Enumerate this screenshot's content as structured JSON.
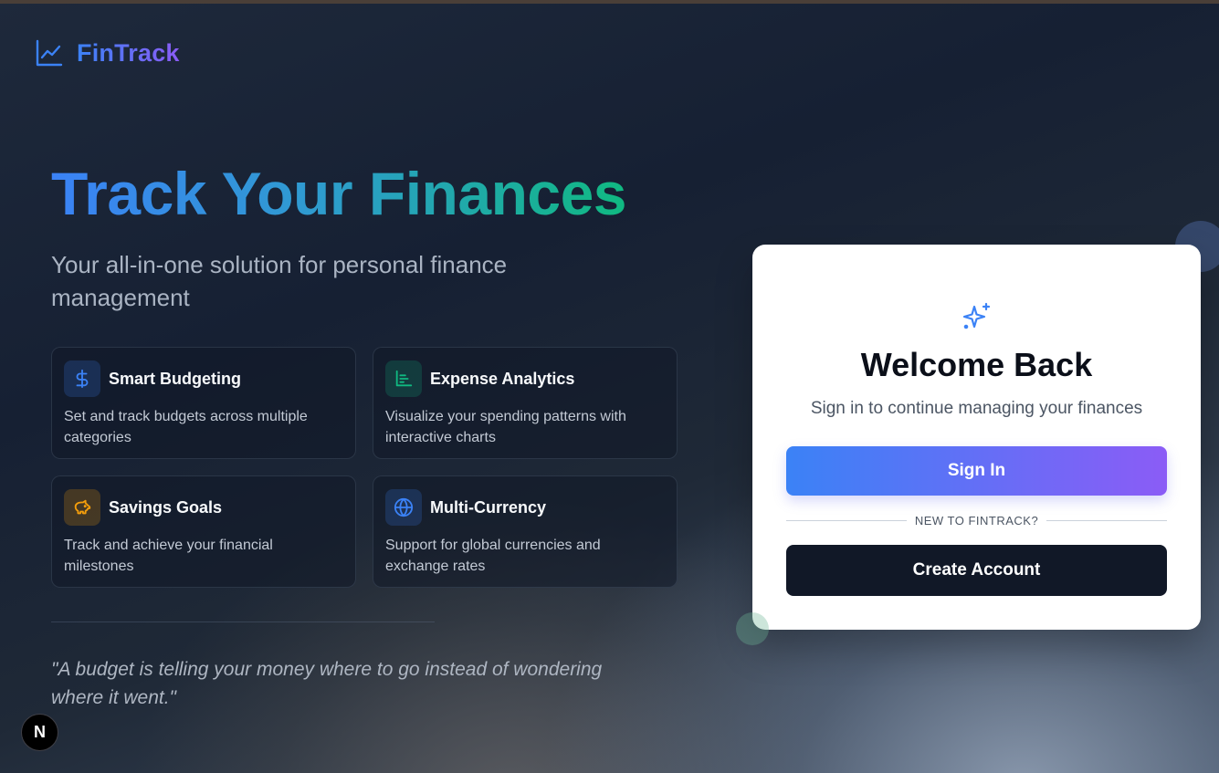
{
  "brand": {
    "name": "FinTrack",
    "icon": "line-chart-icon"
  },
  "hero": {
    "title": "Track Your Finances",
    "subtitle": "Your all-in-one solution for personal finance management"
  },
  "features": [
    {
      "title": "Smart Budgeting",
      "description": "Set and track budgets across multiple categories",
      "icon": "dollar-icon",
      "color": "#3b82f6"
    },
    {
      "title": "Expense Analytics",
      "description": "Visualize your spending patterns with interactive charts",
      "icon": "bar-chart-icon",
      "color": "#10b981"
    },
    {
      "title": "Savings Goals",
      "description": "Track and achieve your financial milestones",
      "icon": "piggy-bank-icon",
      "color": "#f59e0b"
    },
    {
      "title": "Multi-Currency",
      "description": "Support for global currencies and exchange rates",
      "icon": "globe-icon",
      "color": "#3b82f6"
    }
  ],
  "quote": "\"A budget is telling your money where to go instead of wondering where it went.\"",
  "auth_card": {
    "icon": "sparkles-icon",
    "title": "Welcome Back",
    "subtitle": "Sign in to continue managing your finances",
    "sign_in_label": "Sign In",
    "divider_text": "NEW TO FINTRACK?",
    "create_account_label": "Create Account"
  },
  "dev_badge": "N",
  "colors": {
    "accent_blue": "#3b82f6",
    "accent_purple": "#8b5cf6",
    "accent_green": "#10b981",
    "dark_button": "#111827"
  }
}
